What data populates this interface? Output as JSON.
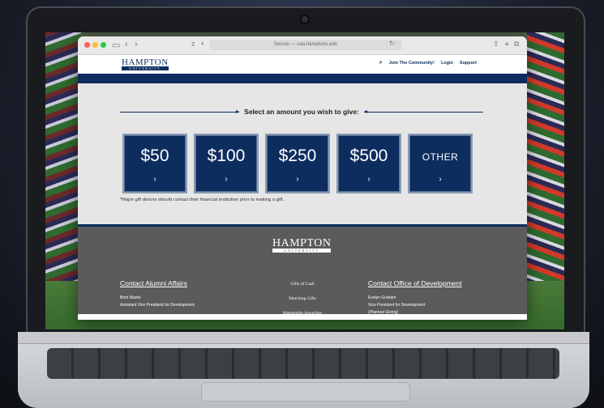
{
  "browser": {
    "url_text": "Secure — oaa.hamptonu.edu",
    "back_glyph": "‹",
    "forward_glyph": "›"
  },
  "site": {
    "logo_main": "HAMPTON",
    "logo_sub": "UNIVERSITY",
    "nav": [
      "Join The Community!",
      "Login",
      "Support"
    ],
    "search_icon": "search-icon"
  },
  "give": {
    "heading": "Select an amount you wish to give:",
    "options": [
      {
        "label": "$50"
      },
      {
        "label": "$100"
      },
      {
        "label": "$250"
      },
      {
        "label": "$500"
      },
      {
        "label": "OTHER"
      }
    ],
    "chevron": "›",
    "note": "*Major gift donors should contact their financial institution prior to making a gift."
  },
  "footer": {
    "logo_main": "HAMPTON",
    "logo_sub": "UNIVERSITY",
    "left": {
      "title": "Contact Alumni Affairs",
      "name": "Brint Martin",
      "role": "Assistant Vice President for Development"
    },
    "middle": [
      "Gifts of Cash",
      "Matching Gifts",
      "Marketable Securities"
    ],
    "right": {
      "title": "Contact Office of Development",
      "name": "Evelyn Graham",
      "role": "Vice President for Development",
      "extra": "(Planned Giving)"
    }
  },
  "colors": {
    "navy": "#0d2d5f",
    "footer_gray": "#5b5b5b",
    "content_bg": "#e6e6e6"
  }
}
